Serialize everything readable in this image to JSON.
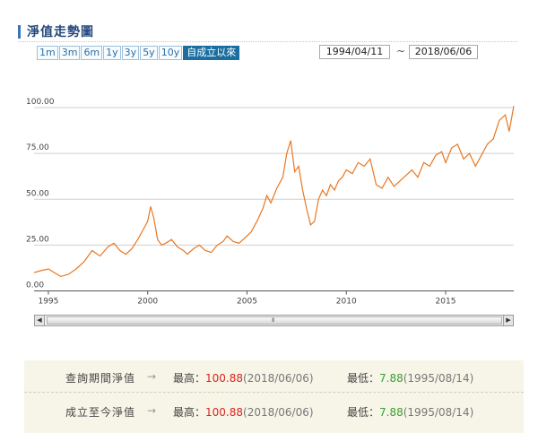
{
  "title": "淨值走勢圖",
  "range_buttons": [
    "1m",
    "3m",
    "6m",
    "1y",
    "3y",
    "5y",
    "10y",
    "自成立以來"
  ],
  "active_range": "自成立以來",
  "date_from": "1994/04/11",
  "date_separator": "~",
  "date_to": "2018/06/06",
  "scroll_grip": "III",
  "summary": {
    "row1": {
      "label": "查詢期間淨值",
      "arrow": "→",
      "high_label": "最高：",
      "high_value": "100.88",
      "high_date": "(2018/06/06)",
      "low_label": "最低：",
      "low_value": "7.88",
      "low_date": "(1995/08/14)"
    },
    "row2": {
      "label": "成立至今淨值",
      "arrow": "→",
      "high_label": "最高：",
      "high_value": "100.88",
      "high_date": "(2018/06/06)",
      "low_label": "最低：",
      "low_value": "7.88",
      "low_date": "(1995/08/14)"
    }
  },
  "colors": {
    "line": "#e87722",
    "title": "#25487d",
    "active_button": "#1b6fa0",
    "high": "#d9251d",
    "low": "#37a02f"
  },
  "chart_data": {
    "type": "line",
    "x_ticks": [
      "1995",
      "2000",
      "2005",
      "2010",
      "2015"
    ],
    "y_ticks": [
      "0.00",
      "25.00",
      "50.00",
      "75.00",
      "100.00"
    ],
    "xlim": [
      1994.28,
      2018.43
    ],
    "ylim": [
      0,
      100
    ],
    "grid": true,
    "series": [
      {
        "x": [
          1994.28,
          1994.6,
          1995.0,
          1995.3,
          1995.62,
          1996.0,
          1996.4,
          1996.8,
          1997.2,
          1997.6,
          1998.0,
          1998.3,
          1998.6,
          1998.9,
          1999.2,
          1999.5,
          1999.8,
          2000.0,
          2000.15,
          2000.3,
          2000.5,
          2000.7,
          2000.9,
          2001.2,
          2001.5,
          2001.8,
          2002.0,
          2002.3,
          2002.6,
          2002.9,
          2003.2,
          2003.5,
          2003.8,
          2004.0,
          2004.3,
          2004.6,
          2004.9,
          2005.2,
          2005.5,
          2005.8,
          2006.0,
          2006.2,
          2006.5,
          2006.8,
          2007.0,
          2007.2,
          2007.4,
          2007.6,
          2007.8,
          2007.9,
          2008.0,
          2008.2,
          2008.4,
          2008.6,
          2008.8,
          2009.0,
          2009.2,
          2009.4,
          2009.6,
          2009.8,
          2010.0,
          2010.3,
          2010.6,
          2010.9,
          2011.2,
          2011.5,
          2011.8,
          2012.1,
          2012.4,
          2012.7,
          2013.0,
          2013.3,
          2013.6,
          2013.9,
          2014.2,
          2014.5,
          2014.8,
          2015.0,
          2015.3,
          2015.6,
          2015.9,
          2016.2,
          2016.5,
          2016.8,
          2017.1,
          2017.4,
          2017.7,
          2018.0,
          2018.2,
          2018.43
        ],
        "values": [
          10,
          11,
          12,
          10,
          7.88,
          9,
          12,
          16,
          22,
          19,
          24,
          26,
          22,
          20,
          23,
          28,
          34,
          38,
          46,
          40,
          28,
          25,
          26,
          28,
          24,
          22,
          20,
          23,
          25,
          22,
          21,
          25,
          27,
          30,
          27,
          26,
          29,
          32,
          38,
          45,
          52,
          48,
          56,
          62,
          75,
          82,
          65,
          68,
          55,
          50,
          45,
          36,
          38,
          50,
          55,
          52,
          58,
          55,
          60,
          62,
          66,
          64,
          70,
          68,
          72,
          58,
          56,
          62,
          57,
          60,
          63,
          66,
          62,
          70,
          68,
          74,
          76,
          70,
          78,
          80,
          72,
          75,
          68,
          74,
          80,
          83,
          93,
          96,
          87,
          100.88
        ]
      }
    ]
  }
}
